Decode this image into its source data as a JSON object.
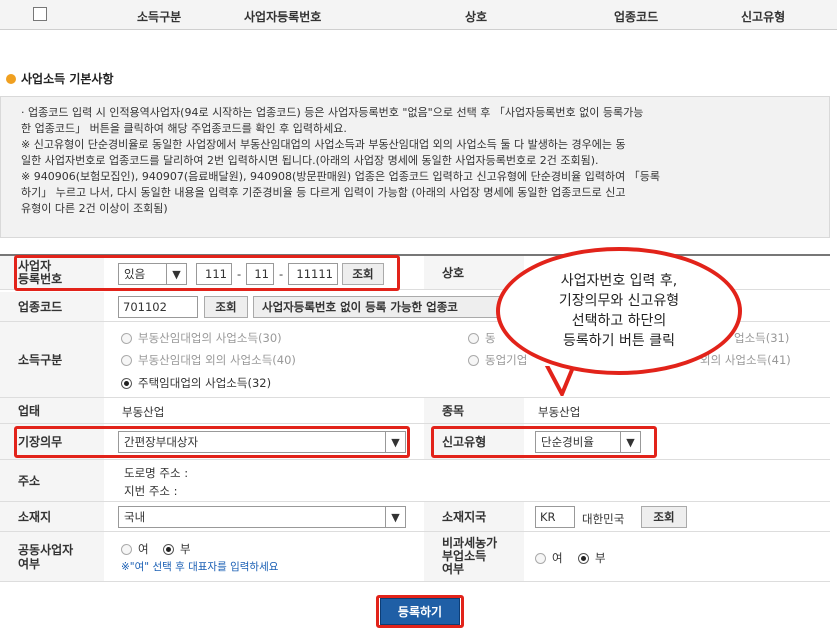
{
  "header": {
    "columns": [
      "소득구분",
      "사업자등록번호",
      "상호",
      "업종코드",
      "신고유형"
    ]
  },
  "section_title": "사업소득 기본사항",
  "notice": {
    "line1": "· 업종코드 입력 시 인적용역사업자(94로 시작하는 업종코드) 등은 사업자등록번호 \"없음\"으로 선택 후 「사업자등록번호 없이 등록가능",
    "line2": "한 업종코드」 버튼을 클릭하여 해당 주업종코드를 확인 후 입력하세요.",
    "line3": "※ 신고유형이 단순경비율로 동일한 사업장에서 부동산임대업의 사업소득과 부동산임대업 외의 사업소득 둘 다 발생하는 경우에는 동",
    "line4": "일한 사업자번호로 업종코드를 달리하여 2번 입력하시면 됩니다.(아래의 사업장 명세에 동일한 사업자등록번호로 2건 조회됨).",
    "line5": "※ 940906(보험모집인), 940907(음료배달원), 940908(방문판매원) 업종은 업종코드 입력하고 신고유형에 단순경비율 입력하여 「등록",
    "line6": "하기」 누르고 나서, 다시 동일한 내용을 입력후 기준경비율 등 다르게 입력이 가능함 (아래의 사업장 명세에 동일한 업종코드로 신고",
    "line7": "유형이 다른 2건 이상이 조회됨)"
  },
  "form": {
    "bizno_label_1": "사업자",
    "bizno_label_2": "등록번호",
    "bizno_select": "있음",
    "bizno_part1": "111",
    "bizno_part2": "11",
    "bizno_part3": "11111",
    "dash": "-",
    "lookup": "조회",
    "shop_label": "상호",
    "industry_label": "업종코드",
    "industry_code": "701102",
    "industry_lookup": "조회",
    "nobiz_button": "사업자등록번호 없이 등록 가능한 업종코",
    "income_label": "소득구분",
    "income_opt1": "부동산임대업의 사업소득(30)",
    "income_opt2": "부동산임대업 외의 사업소득(40)",
    "income_opt3": "주택임대업의 사업소득(32)",
    "income_opt4": "동",
    "income_opt5": "동업기업",
    "income_opt6": "업소득(31)",
    "income_opt7": "외의 사업소득(41)",
    "biztype_label": "업태",
    "biztype_value": "부동산업",
    "item_label": "종목",
    "item_value": "부동산업",
    "bookkeeping_label": "기장의무",
    "bookkeeping_value": "간편장부대상자",
    "report_type_label": "신고유형",
    "report_type_value": "단순경비율",
    "address_label": "주소",
    "road_address": "도로명 주소 :",
    "lot_address": "지번 주소 :",
    "location_label": "소재지",
    "location_value": "국내",
    "country_label": "소재지국",
    "country_code": "KR",
    "country_name": "대한민국",
    "country_lookup": "조회",
    "joint_label_1": "공동사업자",
    "joint_label_2": "여부",
    "yes": "여",
    "no": "부",
    "joint_hint": "※\"여\" 선택 후 대표자를 입력하세요",
    "nontax_label_1": "비과세농가",
    "nontax_label_2": "부업소득",
    "nontax_label_3": "여부"
  },
  "callout": {
    "line1": "사업자번호 입력 후,",
    "line2": "기장의무와 신고유형",
    "line3": "선택하고 하단의",
    "line4": "등록하기 버튼 클릭"
  },
  "submit_label": "등록하기",
  "colors": {
    "highlight": "#e2231a",
    "submit": "#1f5fa6",
    "hint": "#1a5fb4"
  }
}
